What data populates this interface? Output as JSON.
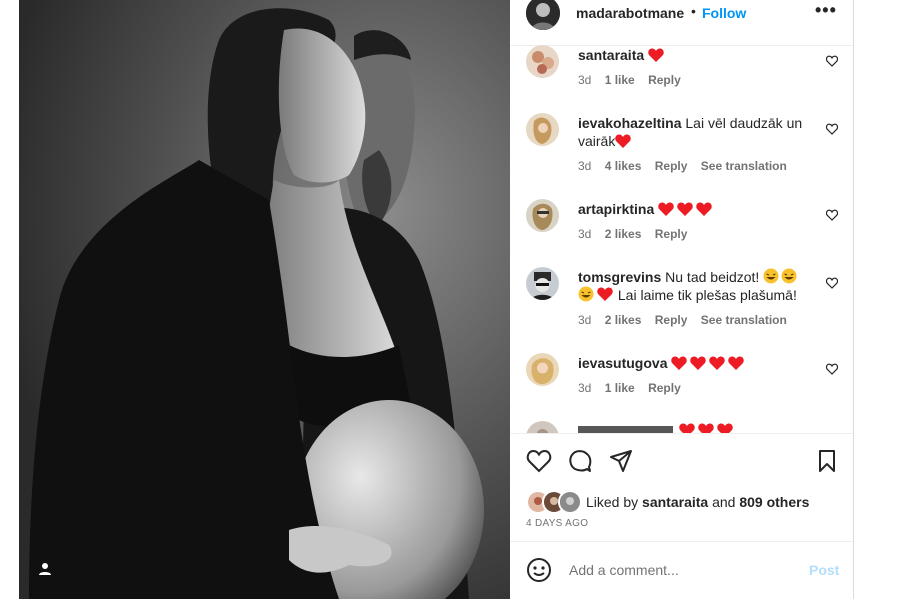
{
  "post": {
    "username": "madarabotmane",
    "separator": "•",
    "follow_label": "Follow",
    "more_label": "•••"
  },
  "comments": [
    {
      "username": "santaraita",
      "text": "",
      "emojis": [
        "red-heart"
      ],
      "age": "3d",
      "likes": "1 like",
      "reply": "Reply",
      "translate": ""
    },
    {
      "username": "ievakohazeltina",
      "text": "Lai vēl daudzāk un vairāk",
      "emojis": [
        "red-heart"
      ],
      "age": "3d",
      "likes": "4 likes",
      "reply": "Reply",
      "translate": "See translation"
    },
    {
      "username": "artapirktina",
      "text": "",
      "emojis": [
        "red-heart",
        "red-heart",
        "red-heart"
      ],
      "age": "3d",
      "likes": "2 likes",
      "reply": "Reply",
      "translate": ""
    },
    {
      "username": "tomsgrevins",
      "text": "Nu tad beidzot!",
      "text2": "Lai laime tik plešas plašumā!",
      "emojis": [
        "laughing",
        "laughing",
        "laughing",
        "red-heart"
      ],
      "age": "3d",
      "likes": "2 likes",
      "reply": "Reply",
      "translate": "See translation"
    },
    {
      "username": "ievasutugova",
      "text": "",
      "emojis": [
        "red-heart",
        "red-heart",
        "red-heart",
        "red-heart"
      ],
      "age": "3d",
      "likes": "1 like",
      "reply": "Reply",
      "translate": ""
    }
  ],
  "likes": {
    "prefix": "Liked by",
    "first_user": "santaraita",
    "conj": "and",
    "others": "809 others",
    "time_ago": "4 DAYS AGO"
  },
  "composer": {
    "placeholder": "Add a comment...",
    "post_label": "Post"
  },
  "colors": {
    "accent": "#0095f6",
    "heart": "#ed1c24",
    "muted": "#737373"
  }
}
